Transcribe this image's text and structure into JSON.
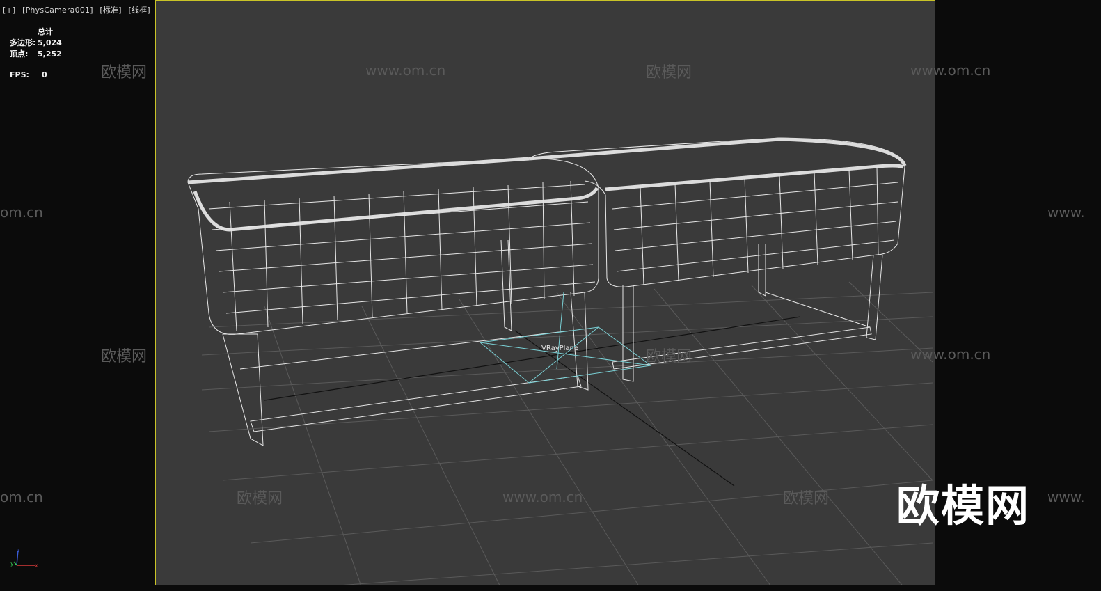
{
  "viewport": {
    "menu": "[+]",
    "camera": "[PhysCamera001]",
    "mode": "[标准]",
    "shading": "[线框]"
  },
  "stats": {
    "header": "总计",
    "poly_label": "多边形:",
    "poly_value": "5,024",
    "vert_label": "顶点:",
    "vert_value": "5,252",
    "fps_label": "FPS:",
    "fps_value": "0"
  },
  "scene": {
    "object_label": "VRayPlane"
  },
  "watermarks": {
    "cn": "欧模网",
    "url": "www.om.cn",
    "url_short": "om.cn",
    "url_prefix": "www.",
    "big_logo": "欧模网"
  },
  "axes": {
    "x": "x",
    "y": "y",
    "z": "z"
  },
  "colors": {
    "viewport_bg": "#3a3a3a",
    "outer_bg": "#0b0b0b",
    "frame_border": "#c9c327",
    "wireframe": "#e8e8e8",
    "light_helper": "#7ad1d6"
  }
}
